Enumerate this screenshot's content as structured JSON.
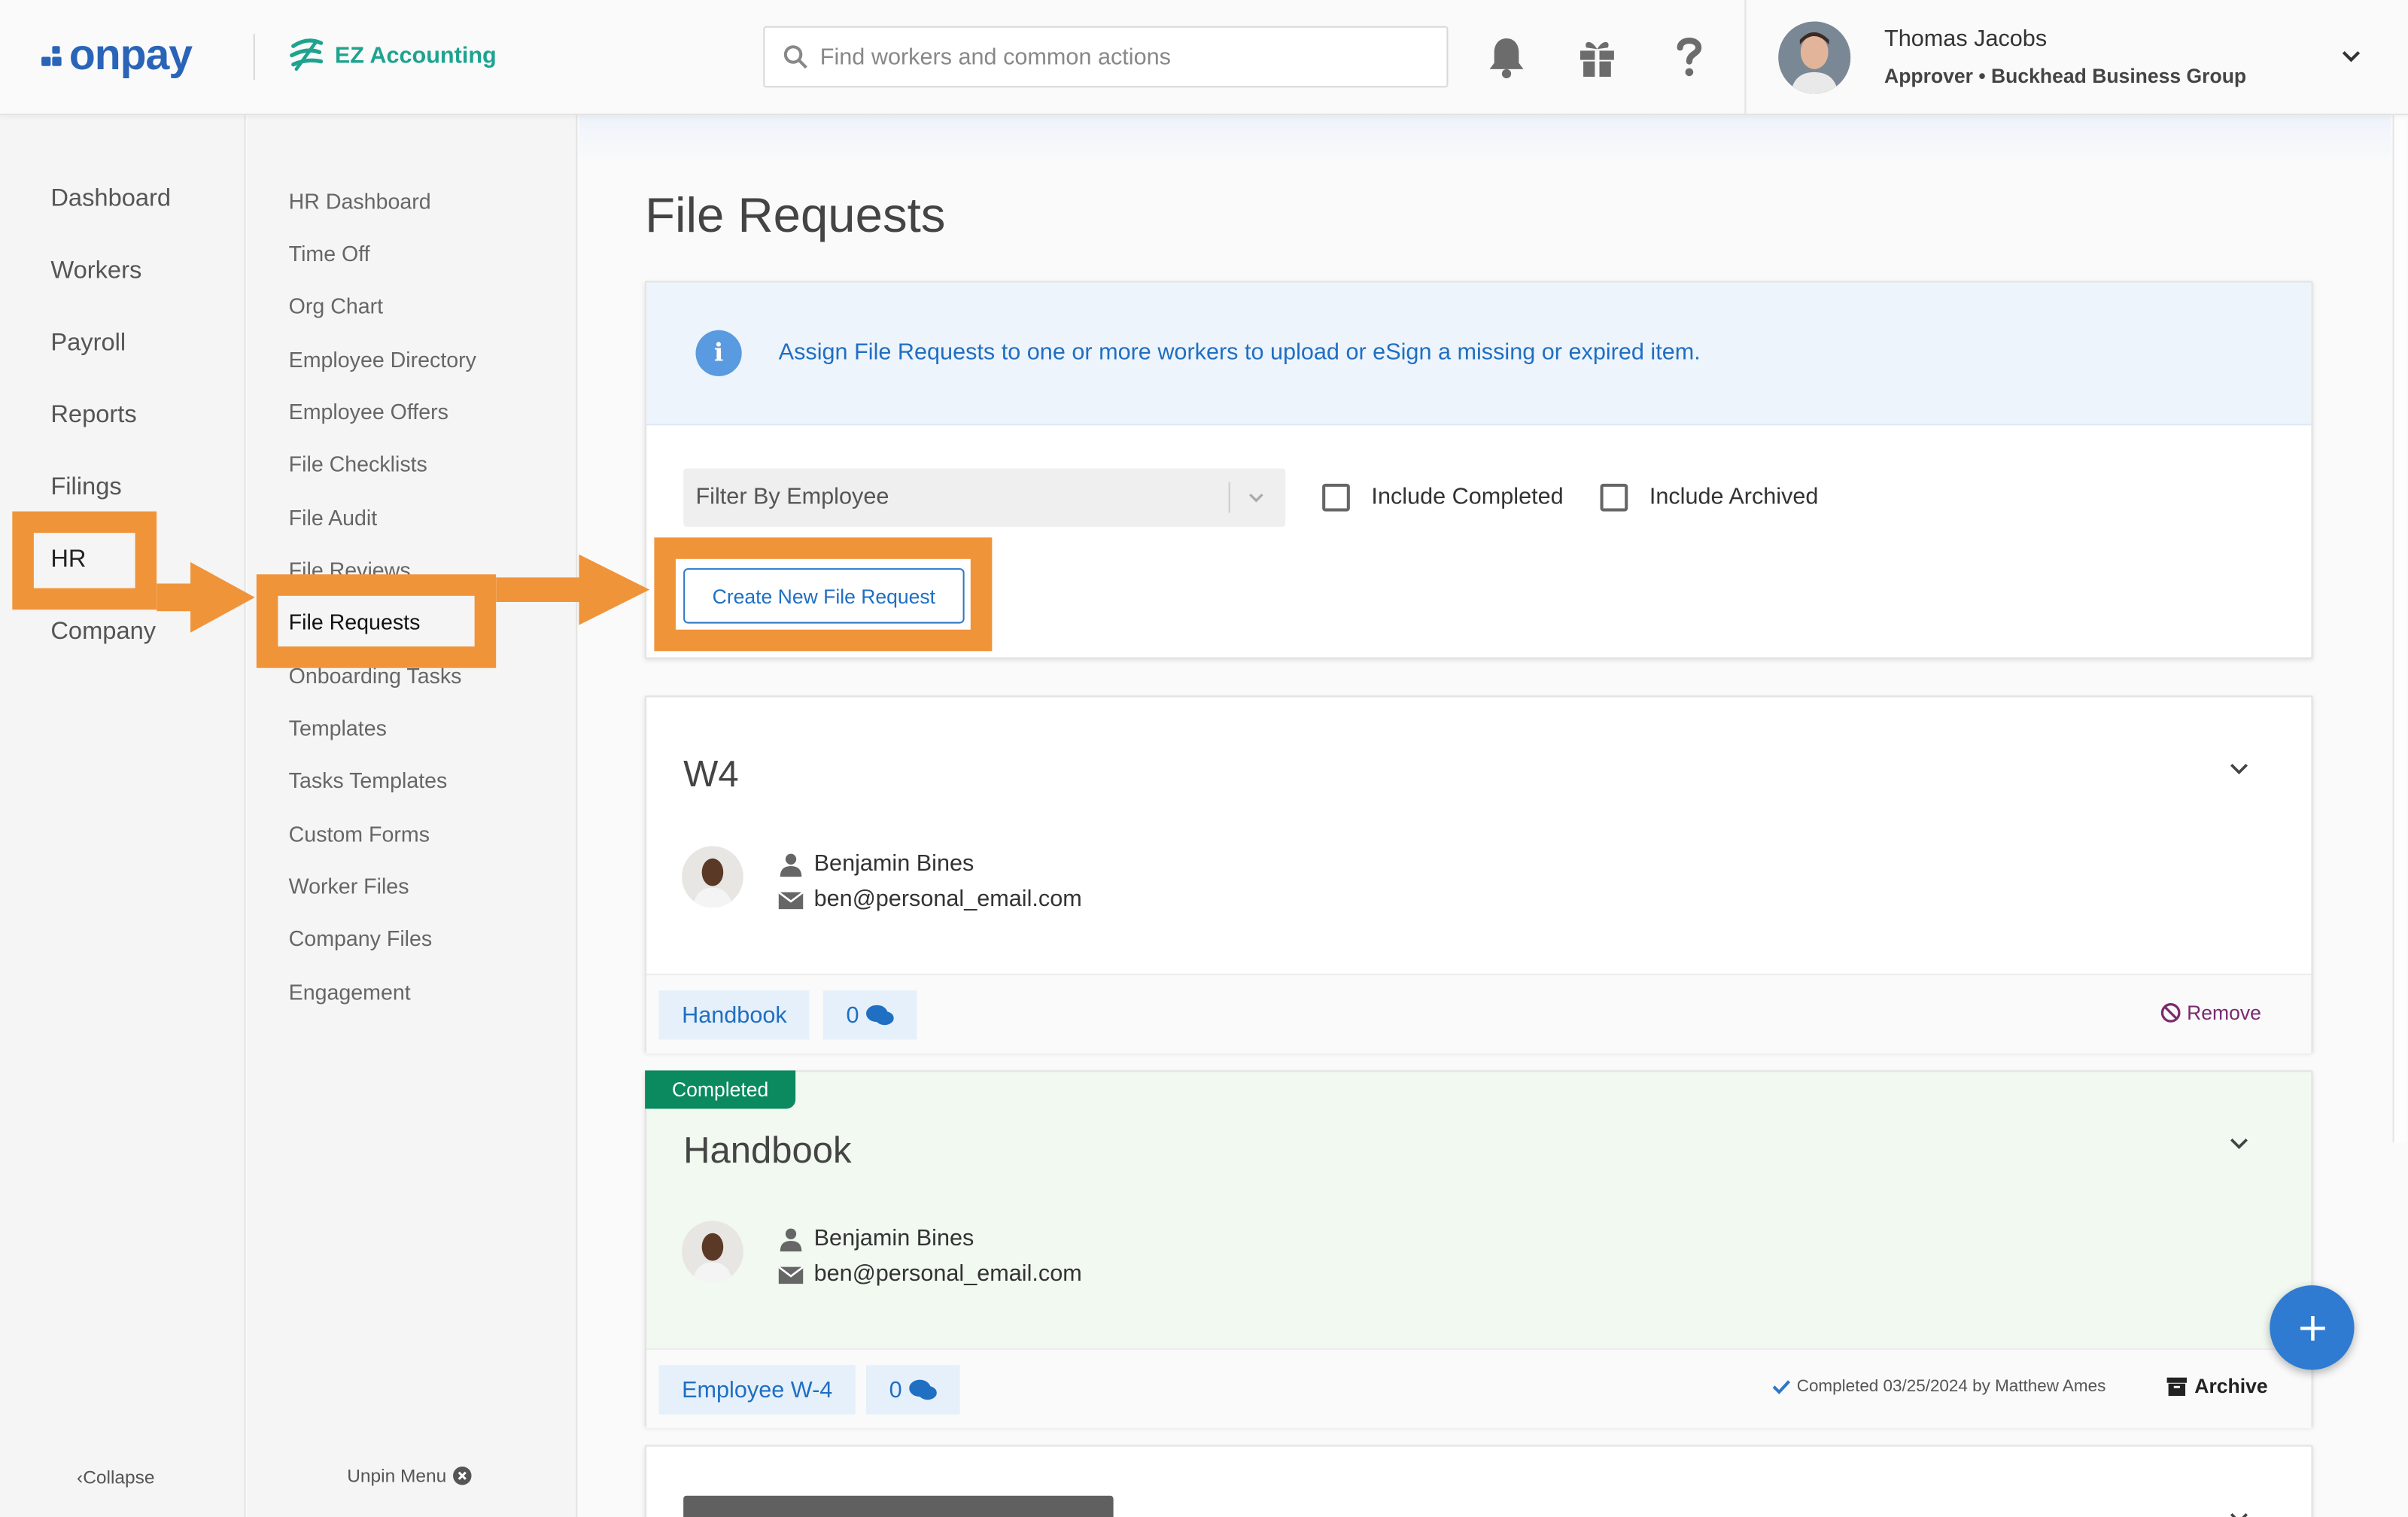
{
  "topbar": {
    "brand": "onpay",
    "partner": "EZ Accounting",
    "search_placeholder": "Find workers and common actions",
    "user_name": "Thomas Jacobs",
    "user_role": "Approver • Buckhead Business Group"
  },
  "nav_primary": {
    "items": [
      "Dashboard",
      "Workers",
      "Payroll",
      "Reports",
      "Filings",
      "HR",
      "Company"
    ],
    "active": "HR",
    "collapse_label": "Collapse"
  },
  "nav_secondary": {
    "items": [
      "HR Dashboard",
      "Time Off",
      "Org Chart",
      "Employee Directory",
      "Employee Offers",
      "File Checklists",
      "File Audit",
      "File Reviews",
      "File Requests",
      "Onboarding Tasks",
      "Templates",
      "Tasks Templates",
      "Custom Forms",
      "Worker Files",
      "Company Files",
      "Engagement"
    ],
    "active": "File Requests",
    "unpin_label": "Unpin Menu"
  },
  "page": {
    "title": "File Requests",
    "info_text": "Assign File Requests to one or more workers to upload or eSign a missing or expired item.",
    "filter_placeholder": "Filter By Employee",
    "include_completed": "Include Completed",
    "include_archived": "Include Archived",
    "create_button": "Create New File Request"
  },
  "requests": [
    {
      "title": "W4",
      "status": "",
      "person_name": "Benjamin Bines",
      "person_email": "ben@personal_email.com",
      "tag": "Handbook",
      "comments": "0",
      "action": "Remove"
    },
    {
      "title": "Handbook",
      "status": "Completed",
      "person_name": "Benjamin Bines",
      "person_email": "ben@personal_email.com",
      "tag": "Employee W-4",
      "comments": "0",
      "completed_note": "Completed 03/25/2024 by Matthew Ames",
      "action": "Archive"
    }
  ],
  "colors": {
    "brand": "#2a64b8",
    "accent": "#1f6fc2",
    "completed": "#0a8a5e",
    "annotation": "#f0943a"
  }
}
